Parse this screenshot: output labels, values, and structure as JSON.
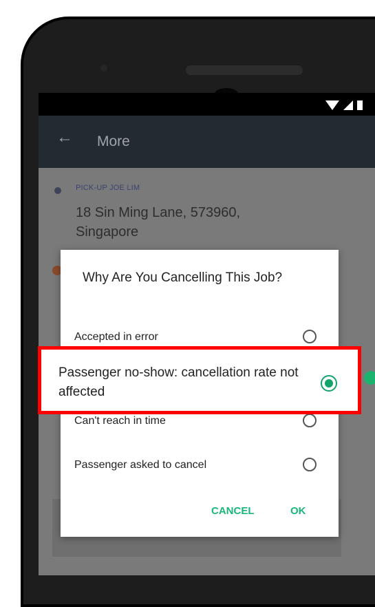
{
  "app_bar": {
    "title": "More"
  },
  "trip": {
    "pickup_label": "PICK-UP JOE LIM",
    "pickup_address": "18 Sin Ming Lane, 573960, Singapore"
  },
  "dialog": {
    "title": "Why Are You Cancelling This Job?",
    "options": [
      {
        "label": "Accepted in error",
        "selected": false
      },
      {
        "label": "Passenger no-show: cancellation rate not affected",
        "selected": true
      },
      {
        "label": "Can't reach in time",
        "selected": false
      },
      {
        "label": "Passenger asked to cancel",
        "selected": false
      }
    ],
    "cancel_label": "CANCEL",
    "ok_label": "OK"
  },
  "colors": {
    "accent": "#1ab67a",
    "highlight_border": "#ff0000",
    "app_bar": "#242a31"
  }
}
